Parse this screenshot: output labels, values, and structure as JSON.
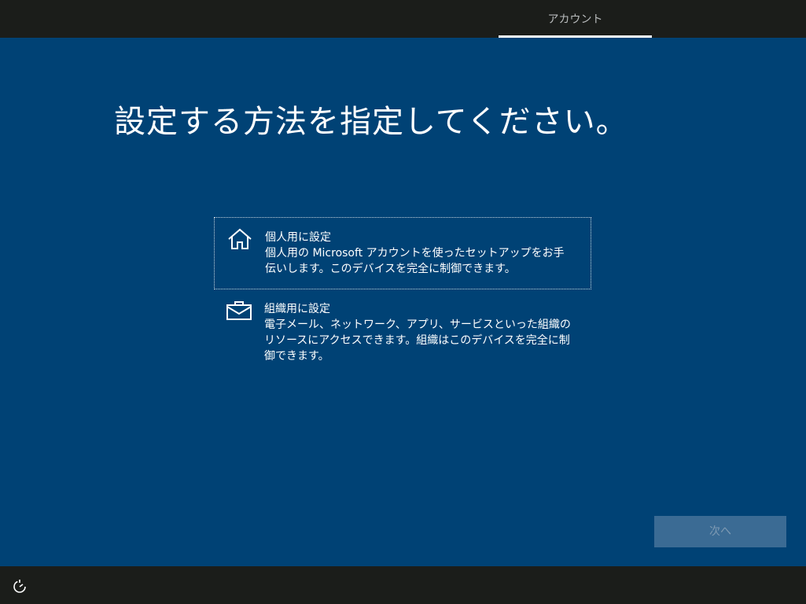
{
  "top_bar": {
    "tabs": [
      {
        "label": "アカウント",
        "active": true
      }
    ]
  },
  "main": {
    "title": "設定する方法を指定してください。",
    "options": [
      {
        "icon": "home-icon",
        "title": "個人用に設定",
        "description": "個人用の Microsoft アカウントを使ったセットアップをお手伝いします。このデバイスを完全に制御できます。",
        "selected": true
      },
      {
        "icon": "briefcase-icon",
        "title": "組織用に設定",
        "description": "電子メール、ネットワーク、アプリ、サービスといった組織のリソースにアクセスできます。組織はこのデバイスを完全に制御できます。",
        "selected": false
      }
    ],
    "next_button": {
      "label": "次へ",
      "enabled": false
    }
  },
  "bottom_bar": {
    "icons": [
      "ease-of-access-icon"
    ]
  },
  "colors": {
    "background": "#004275",
    "bar": "#1b1d1a",
    "text": "#ffffff",
    "button_disabled_bg": "#3b6b94",
    "button_disabled_text": "#7e9ab3"
  }
}
